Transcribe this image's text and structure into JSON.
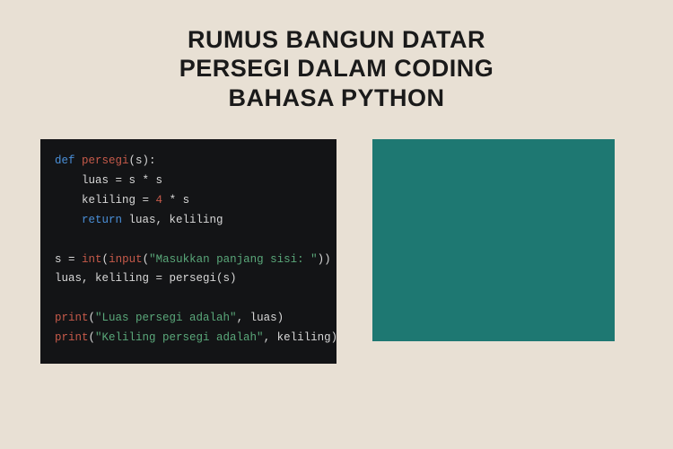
{
  "heading": {
    "line1": "RUMUS BANGUN DATAR",
    "line2": "PERSEGI DALAM CODING",
    "line3": "BAHASA PYTHON"
  },
  "code": {
    "kw_def": "def",
    "fn_persegi": "persegi",
    "p_open": "(s):",
    "line_luas": "    luas ",
    "eq1": "= ",
    "luas_expr": "s * s",
    "line_keliling": "    keliling ",
    "eq2": "= ",
    "num_4": "4",
    "keliling_tail": " * s",
    "kw_return": "    return",
    "return_tail": " luas, keliling",
    "assign_s": "s ",
    "eq3": "= ",
    "fn_int": "int",
    "paren_open1": "(",
    "fn_input": "input",
    "paren_open2": "(",
    "str_prompt": "\"Masukkan panjang sisi: \"",
    "paren_close2": "))",
    "unpack": "luas, keliling ",
    "eq4": "= ",
    "call_persegi": "persegi(s)",
    "fn_print1": "print",
    "p1_open": "(",
    "str_luas": "\"Luas persegi adalah\"",
    "p1_tail": ", luas)",
    "fn_print2": "print",
    "p2_open": "(",
    "str_keliling": "\"Keliling persegi adalah\"",
    "p2_tail": ", keliling)"
  },
  "colors": {
    "background": "#e8e0d4",
    "code_bg": "#131416",
    "teal": "#1e7872",
    "keyword": "#4a8fd8",
    "function": "#c65a4a",
    "string": "#5aa87a"
  }
}
